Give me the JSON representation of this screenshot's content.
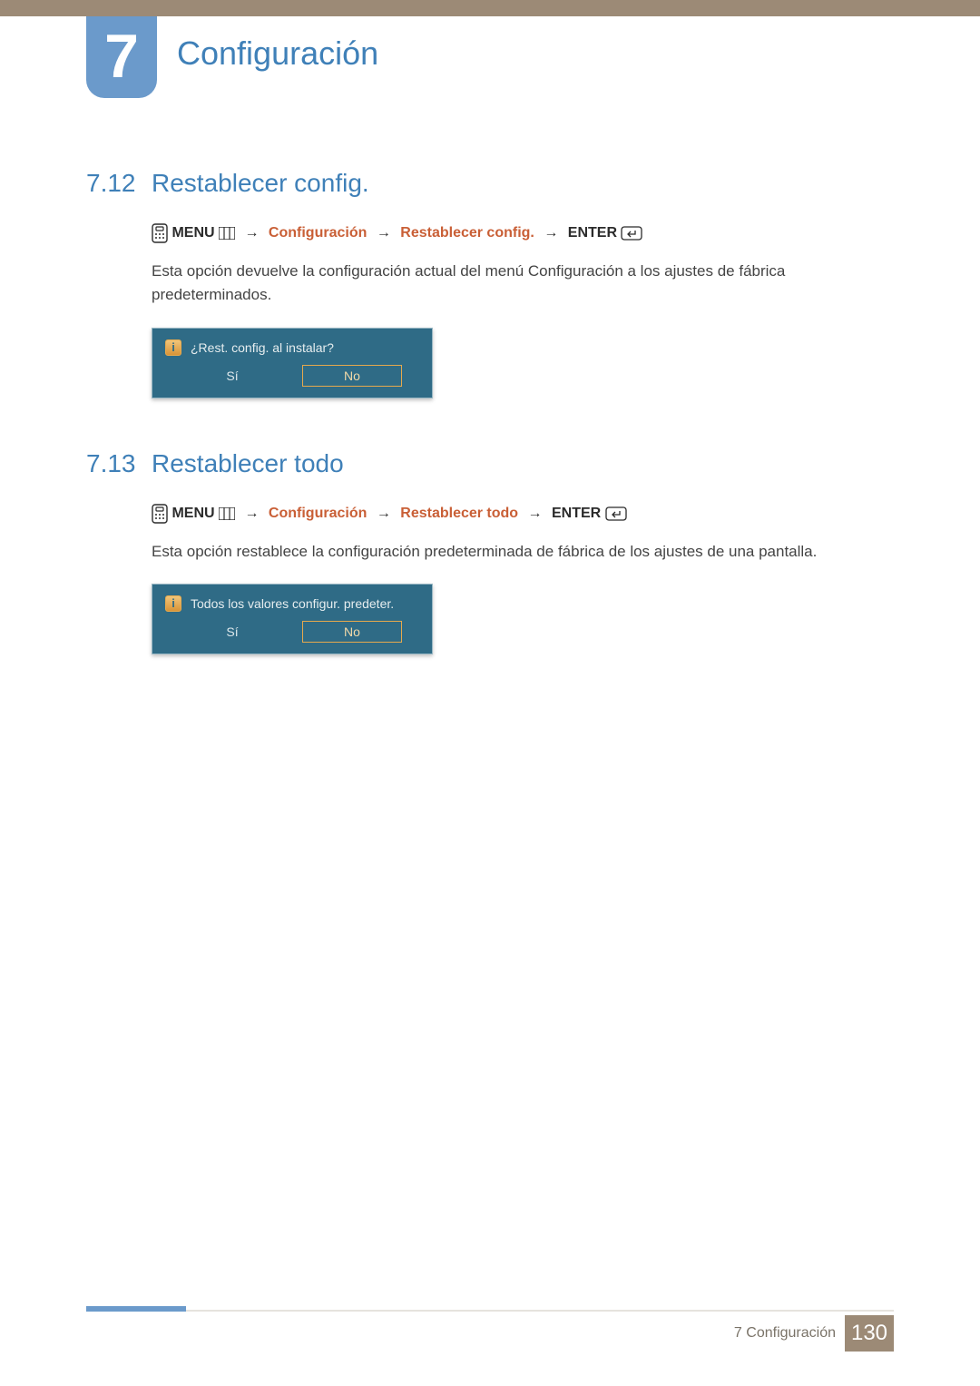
{
  "chapter": {
    "number": "7",
    "title": "Configuración"
  },
  "sections": [
    {
      "number": "7.12",
      "title": "Restablecer config.",
      "nav": {
        "menu_label": "MENU",
        "path_config": "Configuración",
        "path_item": "Restablecer config.",
        "enter_label": "ENTER"
      },
      "description": "Esta opción devuelve la configuración actual del menú Configuración a los ajustes de fábrica predeterminados.",
      "dialog": {
        "question": "¿Rest. config. al instalar?",
        "yes": "Sí",
        "no": "No",
        "highlighted": "no"
      }
    },
    {
      "number": "7.13",
      "title": "Restablecer todo",
      "nav": {
        "menu_label": "MENU",
        "path_config": "Configuración",
        "path_item": "Restablecer todo",
        "enter_label": "ENTER"
      },
      "description": "Esta opción restablece la configuración predeterminada de fábrica de los ajustes de una pantalla.",
      "dialog": {
        "question": "Todos los valores configur. predeter.",
        "yes": "Sí",
        "no": "No",
        "highlighted": "no"
      }
    }
  ],
  "footer": {
    "chapter_ref": "7 Configuración",
    "page_number": "130"
  }
}
